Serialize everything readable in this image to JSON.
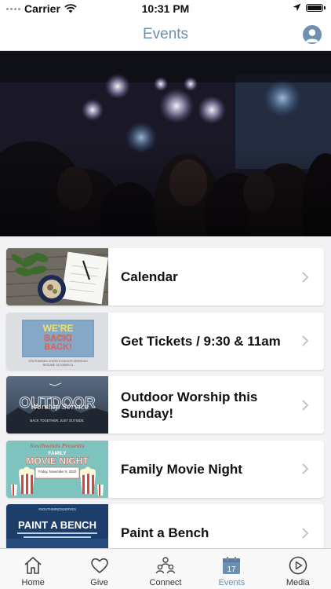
{
  "status_bar": {
    "carrier": "Carrier",
    "time": "10:31 PM"
  },
  "nav": {
    "title": "Events"
  },
  "events": [
    {
      "title": "Calendar"
    },
    {
      "title": "Get Tickets / 9:30 & 11am",
      "thumb": {
        "line1": "WE'RE",
        "line2": "BACK!",
        "caption": "SOUTHWINDS CHURCH INDOOR SERVICES\nRESUME OCTOBER 11"
      }
    },
    {
      "title": "Outdoor Worship this Sunday!",
      "thumb": {
        "headline": "OUTDOOR",
        "script": "Worship Service",
        "caption": "BACK TOGETHER, JUST OUTSIDE."
      }
    },
    {
      "title": "Family Movie Night",
      "thumb": {
        "script": "Southwinds Presents",
        "line1": "FAMILY",
        "line2": "MOVIE NIGHT",
        "caption": "Friday, November 6, 2020"
      }
    },
    {
      "title": "Paint a Bench",
      "thumb": {
        "tag": "#SOUTHWINDSSERVES",
        "headline": "PAINT A BENCH"
      }
    }
  ],
  "tabs": [
    {
      "label": "Home",
      "icon": "home-icon"
    },
    {
      "label": "Give",
      "icon": "heart-icon"
    },
    {
      "label": "Connect",
      "icon": "people-icon"
    },
    {
      "label": "Events",
      "icon": "calendar-icon",
      "calendar_day": "17"
    },
    {
      "label": "Media",
      "icon": "play-icon"
    }
  ],
  "colors": {
    "accent": "#6d8fb0",
    "background": "#f2f2f4",
    "card": "#ffffff"
  }
}
